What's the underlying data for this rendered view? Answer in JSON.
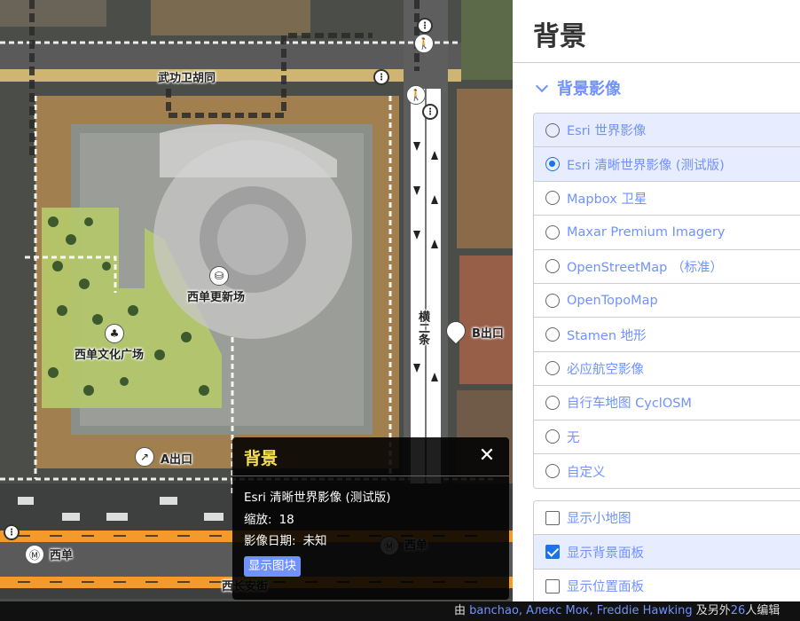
{
  "map": {
    "labels": {
      "wugong": "武功卫胡同",
      "xidan_mall": "西单更新场",
      "xidan_plaza": "西单文化广场",
      "exit_a": "A出口",
      "exit_b": "B出口",
      "xidan_station_1": "西单",
      "xidan_station_2": "西单",
      "xichangan": "西长安街",
      "road_vertical": "横二条"
    }
  },
  "info_panel": {
    "title": "背景",
    "imagery": "Esri 清晰世界影像 (测试版)",
    "zoom_label": "缩放:",
    "zoom_value": "18",
    "date_label": "影像日期:",
    "date_value": "未知",
    "button_label": "显示图块",
    "close_glyph": "✕"
  },
  "footer": {
    "prefix": "由 ",
    "authors": "banchao, Алекс Мок, Freddie Hawking",
    "middle": " 及另外",
    "count": "26",
    "suffix": "人编辑"
  },
  "pane": {
    "title": "背景",
    "section_title": "背景影像",
    "sources": [
      {
        "label": "Esri 世界影像",
        "selected": false
      },
      {
        "label": "Esri 清晰世界影像 (测试版)",
        "selected": true
      },
      {
        "label": "Mapbox 卫星",
        "selected": false
      },
      {
        "label": "Maxar Premium Imagery",
        "selected": false
      },
      {
        "label": "OpenStreetMap （标准）",
        "selected": false
      },
      {
        "label": "OpenTopoMap",
        "selected": false
      },
      {
        "label": "Stamen 地形",
        "selected": false
      },
      {
        "label": "必应航空影像",
        "selected": false
      },
      {
        "label": "自行车地图 CyclOSM",
        "selected": false
      },
      {
        "label": "无",
        "selected": false
      },
      {
        "label": "自定义",
        "selected": false
      }
    ],
    "options": [
      {
        "label": "显示小地图",
        "checked": false
      },
      {
        "label": "显示背景面板",
        "checked": true
      },
      {
        "label": "显示位置面板",
        "checked": false
      }
    ]
  },
  "colors": {
    "accent": "#7092ff",
    "highlight": "#e8ecff",
    "info_title": "#f5e050",
    "radio_on": "#1a73e8"
  }
}
